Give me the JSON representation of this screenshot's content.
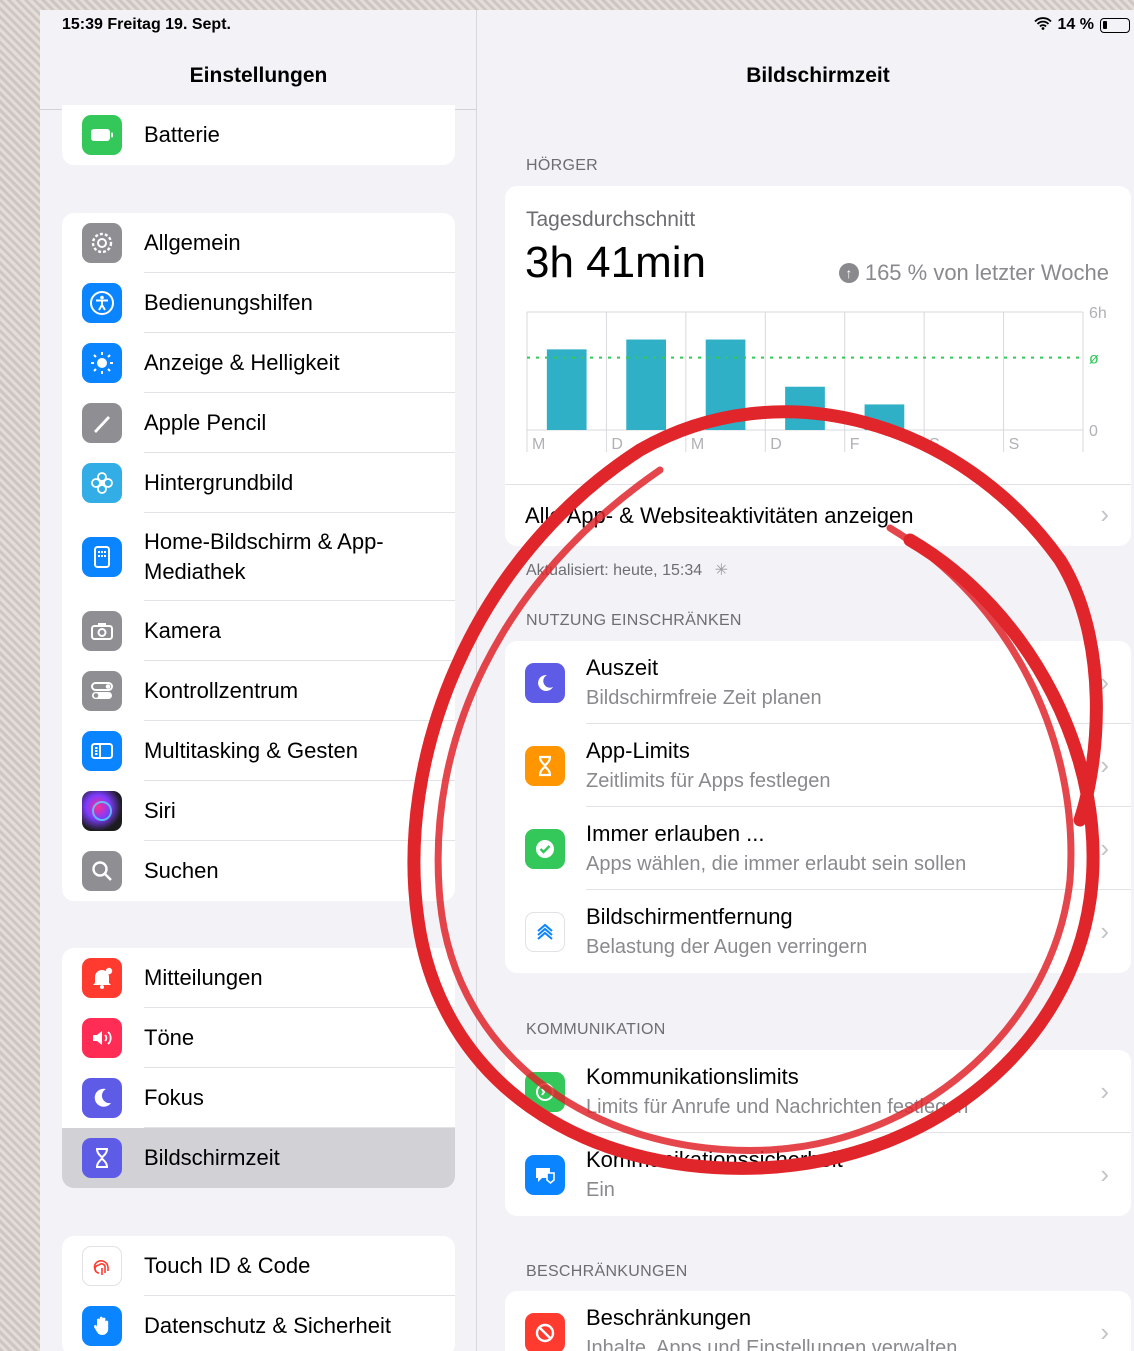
{
  "status_bar": {
    "time_date": "15:39   Freitag 19. Sept.",
    "battery": "14 %"
  },
  "sidebar": {
    "title": "Einstellungen",
    "group0": [
      {
        "label": "Batterie",
        "icon": "battery-icon",
        "color": "#34c759"
      }
    ],
    "group1": [
      {
        "label": "Allgemein",
        "icon": "gear-icon",
        "color": "#8e8e93"
      },
      {
        "label": "Bedienungshilfen",
        "icon": "accessibility-icon",
        "color": "#0a84ff"
      },
      {
        "label": "Anzeige & Helligkeit",
        "icon": "sun-icon",
        "color": "#0a84ff"
      },
      {
        "label": "Apple Pencil",
        "icon": "pencil-icon",
        "color": "#8e8e93"
      },
      {
        "label": "Hintergrundbild",
        "icon": "flower-icon",
        "color": "#32ade6"
      },
      {
        "label": "Home-Bildschirm & App-Mediathek",
        "icon": "home-screen-icon",
        "color": "#0a84ff"
      },
      {
        "label": "Kamera",
        "icon": "camera-icon",
        "color": "#8e8e93"
      },
      {
        "label": "Kontrollzentrum",
        "icon": "toggles-icon",
        "color": "#8e8e93"
      },
      {
        "label": "Multitasking & Gesten",
        "icon": "multitasking-icon",
        "color": "#0a84ff"
      },
      {
        "label": "Siri",
        "icon": "siri-icon",
        "color": "#1c1c1e"
      },
      {
        "label": "Suchen",
        "icon": "search-icon",
        "color": "#8e8e93"
      }
    ],
    "group2": [
      {
        "label": "Mitteilungen",
        "icon": "notification-icon",
        "color": "#ff3b30"
      },
      {
        "label": "Töne",
        "icon": "speaker-icon",
        "color": "#ff2d55"
      },
      {
        "label": "Fokus",
        "icon": "moon-icon",
        "color": "#5e5ce6"
      },
      {
        "label": "Bildschirmzeit",
        "icon": "hourglass-icon",
        "color": "#5e5ce6"
      }
    ],
    "group3": [
      {
        "label": "Touch ID & Code",
        "icon": "fingerprint-icon",
        "color": "#ff3b30"
      },
      {
        "label": "Datenschutz & Sicherheit",
        "icon": "hand-icon",
        "color": "#0a84ff"
      }
    ]
  },
  "detail": {
    "title": "Bildschirmzeit",
    "device_section": "HÖRGER",
    "usage_label": "Tagesdurchschnitt",
    "usage_value": "3h 41min",
    "usage_change": "165 % von letzter Woche",
    "all_activity_link": "Alle App- & Websiteaktivitäten anzeigen",
    "updated": "Aktualisiert: heute, 15:34",
    "limit_section": "NUTZUNG EINSCHRÄNKEN",
    "limit_items": [
      {
        "title": "Auszeit",
        "subtitle": "Bildschirmfreie Zeit planen",
        "icon": "downtime-icon",
        "color": "#5e5ce6"
      },
      {
        "title": "App-Limits",
        "subtitle": "Zeitlimits für Apps festlegen",
        "icon": "hourglass-icon",
        "color": "#ff9500"
      },
      {
        "title": "Immer erlauben ...",
        "subtitle": "Apps wählen, die immer erlaubt sein sollen",
        "icon": "checkmark-badge-icon",
        "color": "#34c759"
      },
      {
        "title": "Bildschirmentfernung",
        "subtitle": "Belastung der Augen verringern",
        "icon": "chevrons-up-icon",
        "color": "#ffffff"
      }
    ],
    "comm_section": "KOMMUNIKATION",
    "comm_items": [
      {
        "title": "Kommunikationslimits",
        "subtitle": "Limits für Anrufe und Nachrichten festlegen",
        "icon": "message-icon",
        "color": "#34c759"
      },
      {
        "title": "Kommunikationssicherheit",
        "subtitle": "Ein",
        "icon": "chat-shield-icon",
        "color": "#0a84ff"
      }
    ],
    "restrict_section": "BESCHRÄNKUNGEN",
    "restrict_items": [
      {
        "title": "Beschränkungen",
        "subtitle": "Inhalte, Apps und Einstellungen verwalten",
        "icon": "prohibited-icon",
        "color": "#ff3b30"
      }
    ]
  },
  "chart_data": {
    "type": "bar",
    "categories": [
      "M",
      "D",
      "M",
      "D",
      "F",
      "S",
      "S"
    ],
    "values": [
      4.1,
      4.6,
      4.6,
      2.2,
      1.3,
      0,
      0
    ],
    "ylim": [
      0,
      6
    ],
    "y_ticks": [
      "6h",
      "ø",
      "0"
    ],
    "average": 3.68,
    "bar_color": "#30b0c7",
    "average_line_color": "#34c759",
    "grid": true
  },
  "annotation": {
    "color": "#e0262b"
  }
}
